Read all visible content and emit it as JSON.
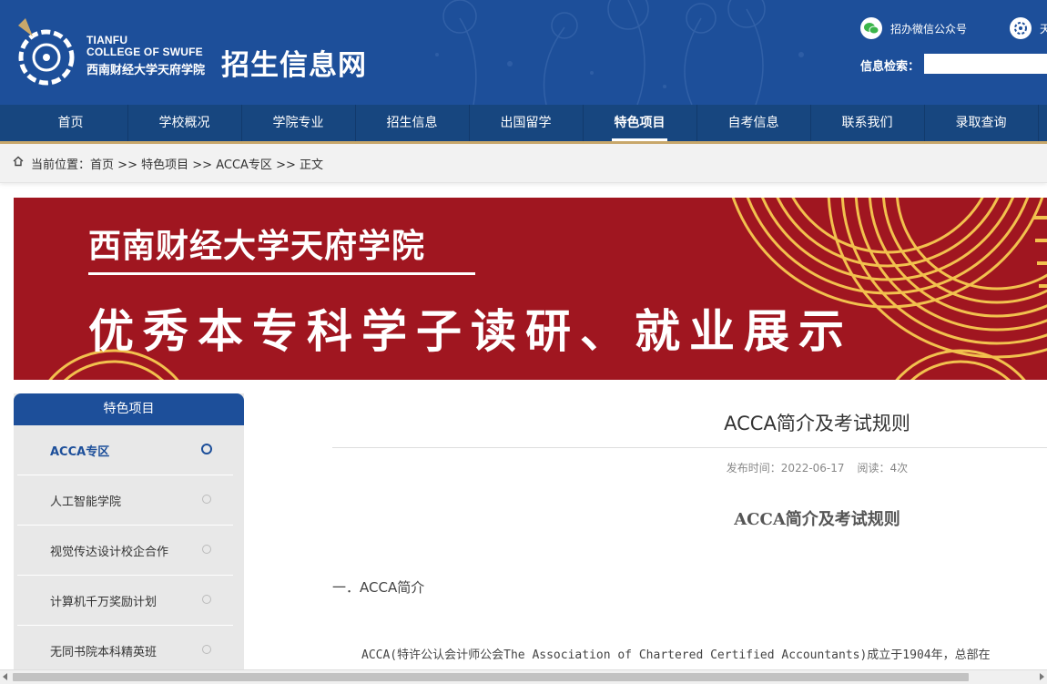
{
  "header": {
    "logo_en_line1": "TIANFU",
    "logo_en_line2": "COLLEGE OF SWUFE",
    "logo_cn": "西南财经大学天府学院",
    "site_title": "招生信息网",
    "wechat_label": "招办微信公众号",
    "weibo_label": "天",
    "search_label": "信息检索：",
    "search_value": ""
  },
  "nav": {
    "items": [
      "首页",
      "学校概况",
      "学院专业",
      "招生信息",
      "出国留学",
      "特色项目",
      "自考信息",
      "联系我们",
      "录取查询"
    ],
    "active": "特色项目"
  },
  "breadcrumb": {
    "prefix": "当前位置：",
    "items": [
      "首页",
      "特色项目",
      "ACCA专区",
      "正文"
    ],
    "separator": ">>"
  },
  "banner": {
    "title": "西南财经大学天府学院",
    "subtitle": "优秀本专科学子读研、就业展示"
  },
  "sidebar": {
    "heading": "特色项目",
    "items": [
      {
        "label": "ACCA专区",
        "active": true
      },
      {
        "label": "人工智能学院",
        "active": false
      },
      {
        "label": "视觉传达设计校企合作",
        "active": false
      },
      {
        "label": "计算机千万奖励计划",
        "active": false
      },
      {
        "label": "无同书院本科精英班",
        "active": false
      }
    ]
  },
  "article": {
    "title": "ACCA简介及考试规则",
    "publish_time": "发布时间：2022-06-17",
    "reads": "阅读：4次",
    "subtitle": "ACCA简介及考试规则",
    "section_heading": "一．ACCA简介",
    "paragraph": "ACCA(特许公认会计师公会The Association of Chartered Certified Accountants)成立于1904年，总部在"
  },
  "colors": {
    "header_blue": "#1d4f9a",
    "nav_blue": "#17467f",
    "banner_red": "#a01620",
    "gold": "#f2c14e"
  }
}
